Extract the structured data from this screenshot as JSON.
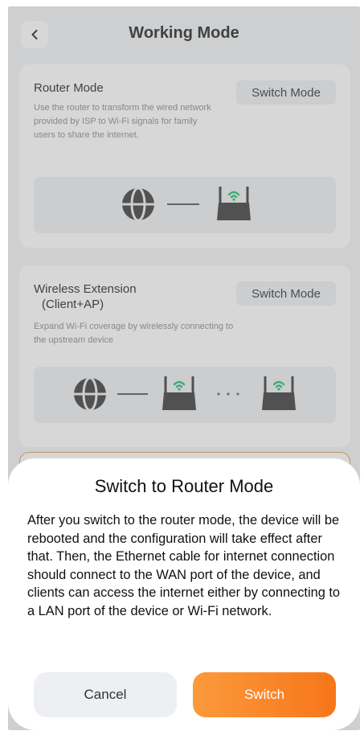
{
  "header": {
    "title": "Working Mode",
    "back_icon": "chevron-left-icon"
  },
  "modes": [
    {
      "title": "Router Mode",
      "description": "Use the router to transform the wired network provided by ISP to Wi-Fi signals for family users to share the internet.",
      "switch_label": "Switch Mode"
    },
    {
      "title_line1": "Wireless Extension",
      "title_line2": "(Client+AP)",
      "description": "Expand Wi-Fi coverage by wirelessly connecting to the upstream device",
      "switch_label": "Switch Mode"
    }
  ],
  "dialog": {
    "title": "Switch to Router Mode",
    "message": "After you switch to the router mode, the device will be rebooted and the configuration will take effect after that. Then, the Ethernet cable for internet connection should connect to the WAN port of the device, and clients can access the internet either by connecting to a LAN port of the device or Wi-Fi network.",
    "cancel_label": "Cancel",
    "confirm_label": "Switch"
  },
  "colors": {
    "accent_start": "#fb9a3c",
    "accent_end": "#f7761a",
    "wifi_green": "#1fbf6b",
    "selected_border": "#e0a050"
  }
}
